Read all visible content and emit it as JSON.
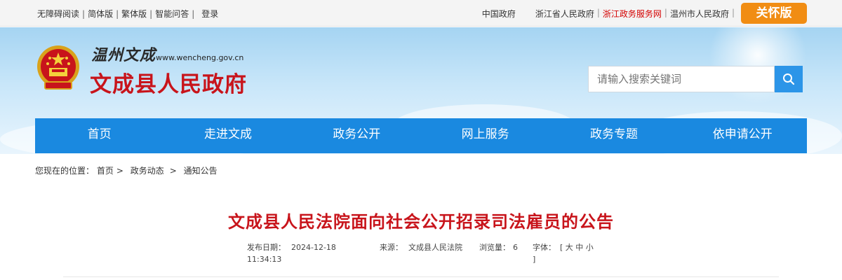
{
  "topbar": {
    "left_links": [
      "无障碍阅读",
      "简体版",
      "繁体版",
      "智能问答",
      "登录"
    ],
    "right_links": [
      "中国政府",
      "浙江省人民政府",
      "浙江政务服务网",
      "温州市人民政府"
    ],
    "care_button": "关怀版"
  },
  "header": {
    "calligraphy": "温州文成",
    "url": "www.wencheng.gov.cn",
    "site_name": "文成县人民政府",
    "search_placeholder": "请输入搜索关键词"
  },
  "nav": [
    "首页",
    "走进文成",
    "政务公开",
    "网上服务",
    "政务专题",
    "依申请公开"
  ],
  "breadcrumb": {
    "prefix": "您现在的位置：",
    "items": [
      "首页",
      "政务动态",
      "通知公告"
    ],
    "separator": ">"
  },
  "article": {
    "title": "文成县人民法院面向社会公开招录司法雇员的公告",
    "date_label": "发布日期：",
    "date": "2024-12-18",
    "time": "11:34:13",
    "source_label": "来源：",
    "source": "文成县人民法院",
    "views_label": "浏览量：",
    "views": "6",
    "font_label": "字体：",
    "font_sizes": [
      "大",
      "中",
      "小"
    ]
  },
  "colors": {
    "nav_bg": "#1a89e0",
    "title_red": "#c8141b",
    "care_orange": "#f18d13",
    "search_blue": "#2c95e8"
  }
}
